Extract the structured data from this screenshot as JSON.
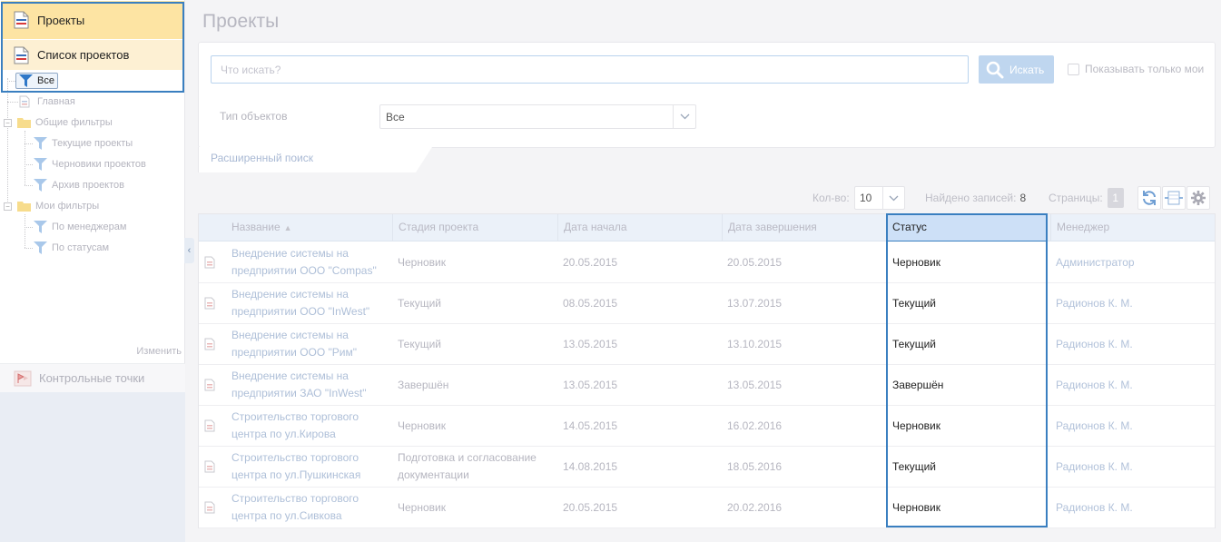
{
  "sidebar": {
    "projects_label": "Проекты",
    "list_label": "Список проектов",
    "tree": {
      "all": "Все",
      "main": "Главная",
      "common_filters": "Общие фильтры",
      "current_projects": "Текущие проекты",
      "draft_projects": "Черновики проектов",
      "archive_projects": "Архив проектов",
      "my_filters": "Мои фильтры",
      "by_managers": "По менеджерам",
      "by_statuses": "По статусам"
    },
    "change_label": "Изменить",
    "checkpoints_label": "Контрольные точки"
  },
  "page": {
    "title": "Проекты"
  },
  "search": {
    "placeholder": "Что искать?",
    "button_label": "Искать",
    "only_mine_label": "Показывать только мои",
    "type_label": "Тип объектов",
    "type_value": "Все",
    "advanced_label": "Расширенный поиск"
  },
  "toolbar": {
    "qty_label": "Кол-во:",
    "qty_value": "10",
    "found_label": "Найдено записей:",
    "found_value": "8",
    "pages_label": "Страницы:",
    "page_value": "1"
  },
  "table": {
    "columns": {
      "name": "Название",
      "stage": "Стадия проекта",
      "start": "Дата начала",
      "end": "Дата завершения",
      "status": "Статус",
      "manager": "Менеджер"
    },
    "rows": [
      {
        "name1": "Внедрение системы на",
        "name2": "предприятии ООО \"Compas\"",
        "stage1": "Черновик",
        "stage2": "",
        "start": "20.05.2015",
        "end": "20.05.2015",
        "status": "Черновик",
        "manager": "Администратор"
      },
      {
        "name1": "Внедрение системы на",
        "name2": "предприятии ООО \"InWest\"",
        "stage1": "Текущий",
        "stage2": "",
        "start": "08.05.2015",
        "end": "13.07.2015",
        "status": "Текущий",
        "manager": "Радионов К. М."
      },
      {
        "name1": "Внедрение системы на",
        "name2": "предприятии ООО \"Рим\"",
        "stage1": "Текущий",
        "stage2": "",
        "start": "13.05.2015",
        "end": "13.10.2015",
        "status": "Текущий",
        "manager": "Радионов К. М."
      },
      {
        "name1": "Внедрение системы на",
        "name2": "предприятии ЗАО \"InWest\"",
        "stage1": "Завершён",
        "stage2": "",
        "start": "13.05.2015",
        "end": "13.05.2015",
        "status": "Завершён",
        "manager": "Радионов К. М."
      },
      {
        "name1": "Строительство торгового",
        "name2": "центра по ул.Кирова",
        "stage1": "Черновик",
        "stage2": "",
        "start": "14.05.2015",
        "end": "16.02.2016",
        "status": "Черновик",
        "manager": "Радионов К. М."
      },
      {
        "name1": "Строительство торгового",
        "name2": "центра по ул.Пушкинская",
        "stage1": "Подготовка и согласование",
        "stage2": "документации",
        "start": "14.08.2015",
        "end": "18.05.2016",
        "status": "Текущий",
        "manager": "Радионов К. М."
      },
      {
        "name1": "Строительство торгового",
        "name2": "центра по ул.Сивкова",
        "stage1": "Черновик",
        "stage2": "",
        "start": "20.05.2015",
        "end": "20.02.2016",
        "status": "Черновик",
        "manager": "Радионов К. М."
      }
    ]
  },
  "colors": {
    "accent_blue": "#3a7fc0",
    "header_active": "#fde4a3",
    "header_sub": "#fdf0d3",
    "grid_header": "#ebf1f9",
    "status_header": "#cde0f7",
    "search_button": "#bfd6ef"
  },
  "icons": {
    "project": "document-icon",
    "filter": "funnel-icon",
    "folder": "folder-icon",
    "search": "search-icon",
    "refresh": "refresh-icon",
    "columns": "column-width-icon",
    "settings": "gear-icon",
    "checkpoints": "flag-icon",
    "collapse": "chevron-left-icon",
    "dropdown": "chevron-down-icon"
  }
}
